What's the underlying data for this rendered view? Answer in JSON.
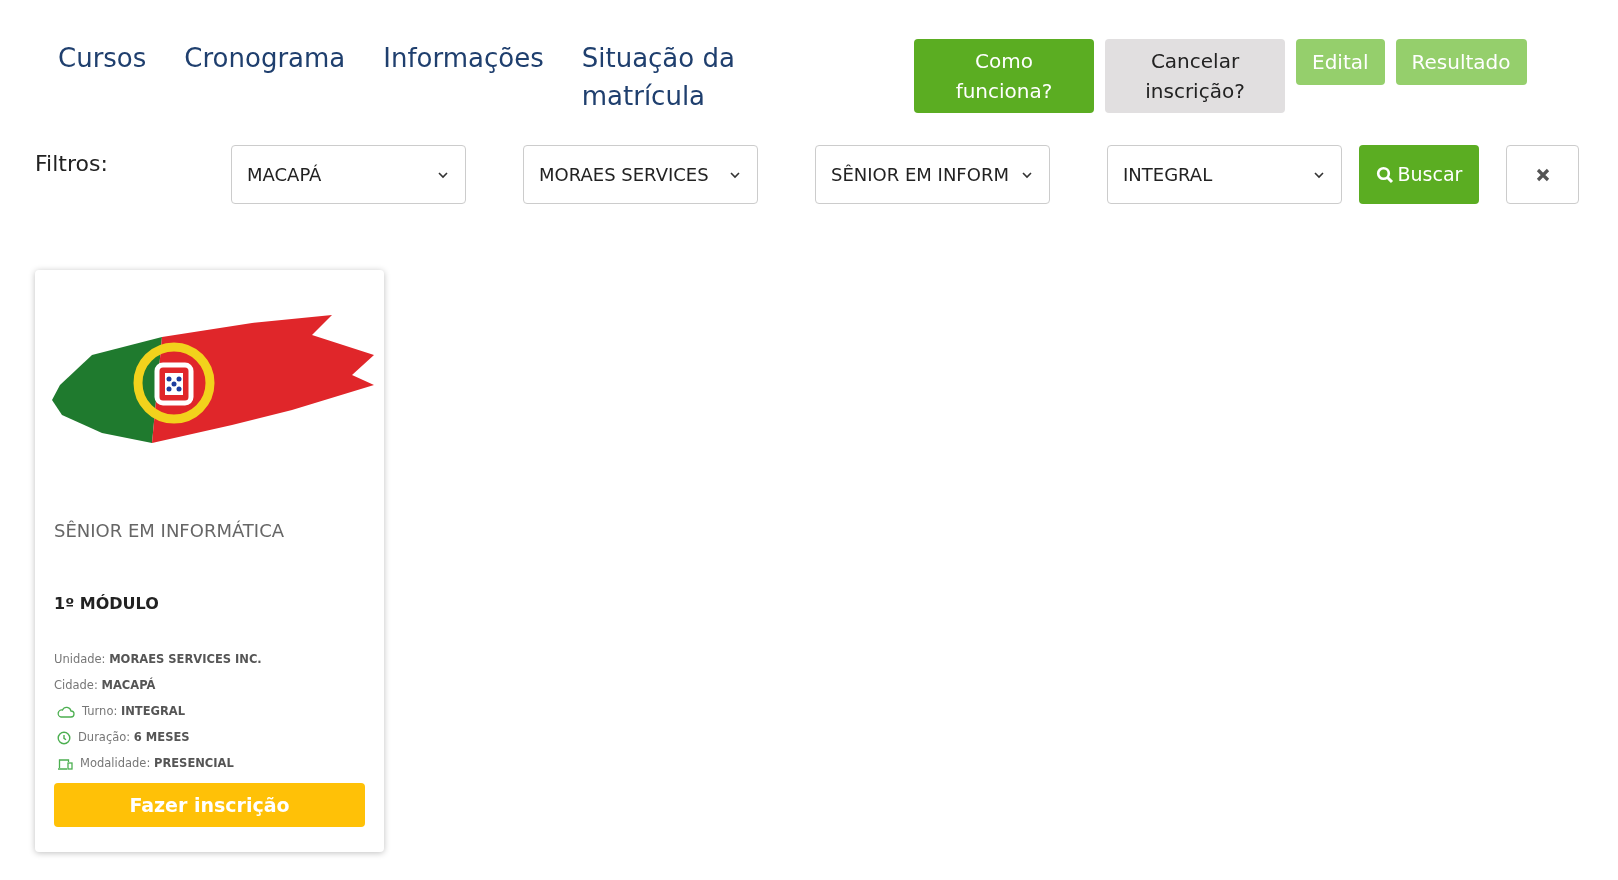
{
  "nav": [
    {
      "label": "Cursos"
    },
    {
      "label": "Cronograma"
    },
    {
      "label": "Informações"
    },
    {
      "label": "Situação da matrícula"
    }
  ],
  "actions": [
    {
      "label": "Como funciona?",
      "kind": "primary",
      "disabled": false
    },
    {
      "label": "Cancelar inscrição?",
      "kind": "secondary",
      "disabled": false
    },
    {
      "label": "Edital",
      "kind": "primary",
      "disabled": true
    },
    {
      "label": "Resultado",
      "kind": "primary",
      "disabled": true
    }
  ],
  "filters": {
    "label": "Filtros:",
    "selects": [
      {
        "value": "MACAPÁ"
      },
      {
        "value": "MORAES SERVICES"
      },
      {
        "value": "SÊNIOR EM INFORM"
      },
      {
        "value": "INTEGRAL"
      }
    ],
    "search_button": "Buscar"
  },
  "courses": [
    {
      "title": "SÊNIOR EM INFORMÁTICA",
      "module": "1º MÓDULO",
      "details": [
        {
          "kind": "plain",
          "label": "Unidade:",
          "value": "MORAES SERVICES INC."
        },
        {
          "kind": "plain",
          "label": "Cidade:",
          "value": "MACAPÁ"
        },
        {
          "kind": "shift",
          "label": "Turno:",
          "value": "INTEGRAL"
        },
        {
          "kind": "duration",
          "label": "Duração:",
          "value": "6 MESES"
        },
        {
          "kind": "mode",
          "label": "Modalidade:",
          "value": "PRESENCIAL"
        }
      ],
      "button": "Fazer inscrição"
    }
  ]
}
